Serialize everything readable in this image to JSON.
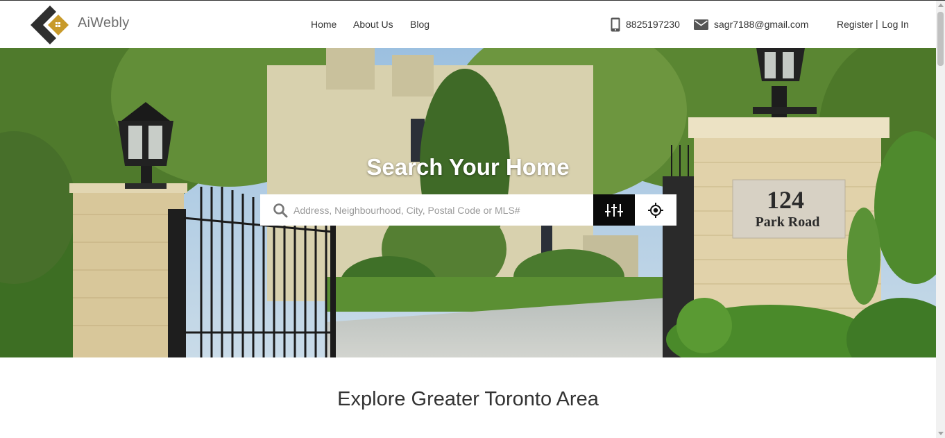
{
  "brand": {
    "name": "AiWebly",
    "accent": "#c89a2a",
    "dark": "#2f2f2f"
  },
  "nav": {
    "home": "Home",
    "about": "About Us",
    "blog": "Blog"
  },
  "contact": {
    "phone": "8825197230",
    "email": "sagr7188@gmail.com"
  },
  "auth": {
    "register": "Register",
    "separator": "|",
    "login": "Log In"
  },
  "hero": {
    "title": "Search Your Home",
    "search_placeholder": "Address, Neighbourhood, City, Postal Code or MLS#",
    "sign_number": "124",
    "sign_street": "Park Road"
  },
  "section": {
    "title": "Explore Greater Toronto Area"
  },
  "icons": {
    "search": "search-icon",
    "filter": "sliders-icon",
    "locate": "crosshair-icon",
    "phone": "phone-icon",
    "mail": "mail-icon"
  }
}
